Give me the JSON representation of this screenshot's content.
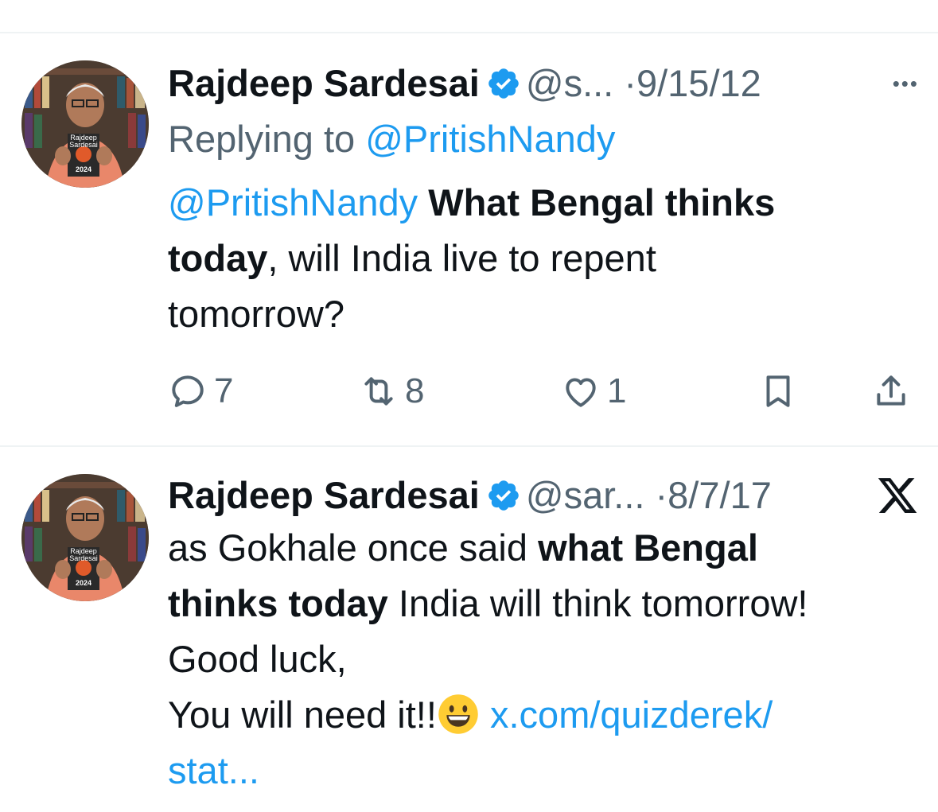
{
  "tweets": [
    {
      "name": "Rajdeep Sardesai",
      "handle": "@s...",
      "sep": "·",
      "date": "9/15/12",
      "more_label": "•••",
      "reply_prefix": "Replying to ",
      "reply_to": "@PritishNandy",
      "body": {
        "mention": "@PritishNandy",
        "bold1": " What Bengal thinks",
        "bold2": "today",
        "rest1": ", will India live to repent",
        "rest2": "tomorrow?"
      },
      "avatar_book": {
        "line1": "Rajdeep",
        "line2": "Sardesai",
        "year": "2024"
      },
      "actions": {
        "replies": "7",
        "reposts": "8",
        "likes": "1",
        "icons": [
          "reply-icon",
          "repost-icon",
          "like-icon",
          "bookmark-icon",
          "share-icon"
        ]
      }
    },
    {
      "name": "Rajdeep Sardesai",
      "handle": "@sar...",
      "sep": "·",
      "date": "8/7/17",
      "avatar_book": {
        "line1": "Rajdeep",
        "line2": "Sardesai",
        "year": "2024"
      },
      "body": {
        "line1_text": "as Gokhale once said ",
        "line1_bold": "what Bengal",
        "line2_bold": "thinks today",
        "line2_text": " India will think tomorrow!",
        "line3": "Good luck,",
        "line4_text": "You will need it!!",
        "link": " x.com/quizderek/",
        "link2": "stat..."
      },
      "source_icon": "x-logo-icon"
    }
  ],
  "colors": {
    "accent": "#1d9bf0",
    "verified": "#1d9bf0",
    "muted": "#536471",
    "text": "#0f1419"
  }
}
